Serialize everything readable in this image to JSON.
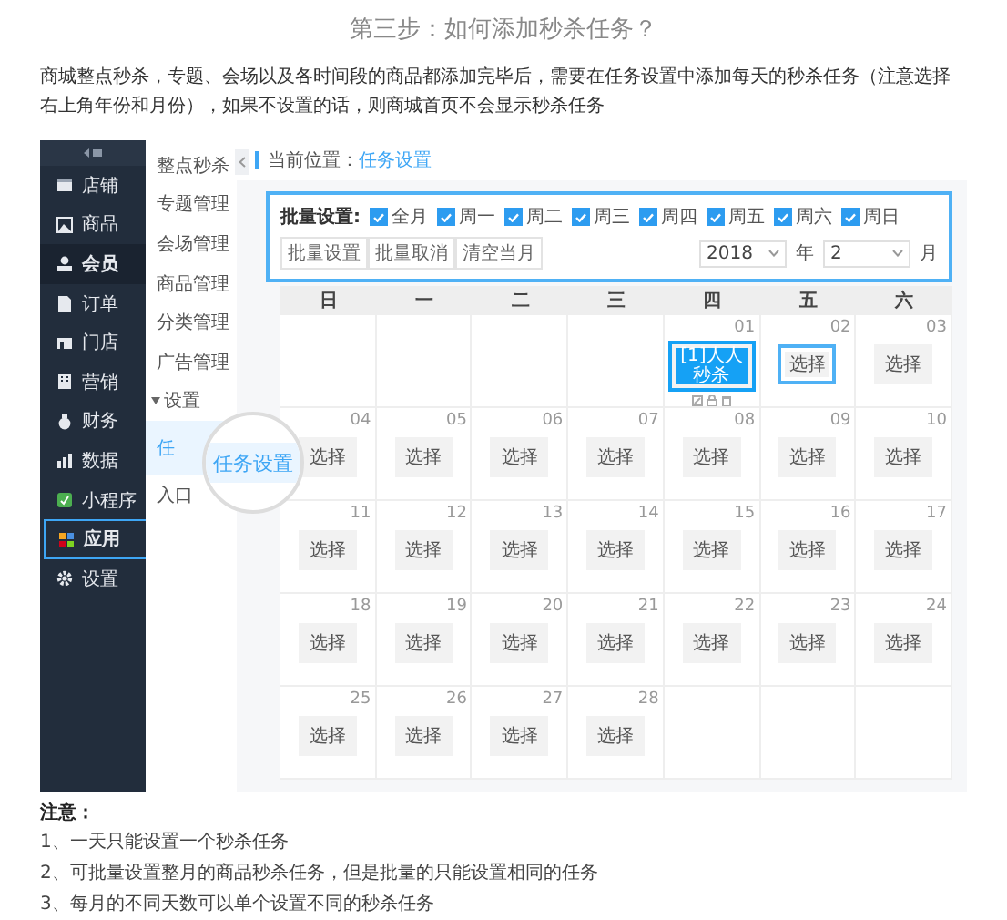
{
  "title": "第三步：如何添加秒杀任务？",
  "intro": "商城整点秒杀，专题、会场以及各时间段的商品都添加完毕后，需要在任务设置中添加每天的秒杀任务（注意选择右上角年份和月份），如果不设置的话，则商城首页不会显示秒杀任务",
  "app": {
    "sidebar": [
      {
        "label": "店铺",
        "selected": false,
        "outlined": false
      },
      {
        "label": "商品",
        "selected": false,
        "outlined": false
      },
      {
        "label": "会员",
        "selected": true,
        "outlined": false
      },
      {
        "label": "订单",
        "selected": false,
        "outlined": false
      },
      {
        "label": "门店",
        "selected": false,
        "outlined": false
      },
      {
        "label": "营销",
        "selected": false,
        "outlined": false
      },
      {
        "label": "财务",
        "selected": false,
        "outlined": false
      },
      {
        "label": "数据",
        "selected": false,
        "outlined": false
      },
      {
        "label": "小程序",
        "selected": false,
        "outlined": false
      },
      {
        "label": "应用",
        "selected": false,
        "outlined": true
      },
      {
        "label": "设置",
        "selected": false,
        "outlined": false
      }
    ],
    "submenu": [
      {
        "label": "整点秒杀",
        "kind": "item",
        "selected": false
      },
      {
        "label": "专题管理",
        "kind": "item",
        "selected": false
      },
      {
        "label": "会场管理",
        "kind": "item",
        "selected": false
      },
      {
        "label": "商品管理",
        "kind": "item",
        "selected": false
      },
      {
        "label": "分类管理",
        "kind": "item",
        "selected": false
      },
      {
        "label": "广告管理",
        "kind": "item",
        "selected": false
      },
      {
        "label": "设置",
        "kind": "group",
        "selected": false
      },
      {
        "label": "任",
        "kind": "item",
        "selected": true
      },
      {
        "label": "入口",
        "kind": "item",
        "selected": false
      }
    ],
    "breadcrumb": {
      "label": "当前位置：",
      "current": "任务设置"
    },
    "batch": {
      "label": "批量设置:",
      "options": [
        {
          "label": "全月",
          "checked": true
        },
        {
          "label": "周一",
          "checked": true
        },
        {
          "label": "周二",
          "checked": true
        },
        {
          "label": "周三",
          "checked": true
        },
        {
          "label": "周四",
          "checked": true
        },
        {
          "label": "周五",
          "checked": true
        },
        {
          "label": "周六",
          "checked": true
        },
        {
          "label": "周日",
          "checked": true
        }
      ],
      "buttons": [
        "批量设置",
        "批量取消",
        "清空当月"
      ],
      "year": "2018",
      "year_unit": "年",
      "month": "2",
      "month_unit": "月"
    },
    "calendar": {
      "weekdays": [
        "日",
        "一",
        "二",
        "三",
        "四",
        "五",
        "六"
      ],
      "weeks": [
        [
          {
            "day": "01",
            "kind": "task",
            "label": "[1]人人秒杀",
            "selected": false
          },
          {
            "day": "02",
            "kind": "choose",
            "label": "选择",
            "selected": true
          },
          {
            "day": "03",
            "kind": "choose",
            "label": "选择",
            "selected": false
          }
        ],
        [
          {
            "day": "04",
            "kind": "choose",
            "label": "选择",
            "selected": false
          },
          {
            "day": "05",
            "kind": "choose",
            "label": "选择",
            "selected": false
          },
          {
            "day": "06",
            "kind": "choose",
            "label": "选择",
            "selected": false
          },
          {
            "day": "07",
            "kind": "choose",
            "label": "选择",
            "selected": false
          },
          {
            "day": "08",
            "kind": "choose",
            "label": "选择",
            "selected": false
          },
          {
            "day": "09",
            "kind": "choose",
            "label": "选择",
            "selected": false
          },
          {
            "day": "10",
            "kind": "choose",
            "label": "选择",
            "selected": false
          }
        ],
        [
          {
            "day": "11",
            "kind": "choose",
            "label": "选择",
            "selected": false
          },
          {
            "day": "12",
            "kind": "choose",
            "label": "选择",
            "selected": false
          },
          {
            "day": "13",
            "kind": "choose",
            "label": "选择",
            "selected": false
          },
          {
            "day": "14",
            "kind": "choose",
            "label": "选择",
            "selected": false
          },
          {
            "day": "15",
            "kind": "choose",
            "label": "选择",
            "selected": false
          },
          {
            "day": "16",
            "kind": "choose",
            "label": "选择",
            "selected": false
          },
          {
            "day": "17",
            "kind": "choose",
            "label": "选择",
            "selected": false
          }
        ],
        [
          {
            "day": "18",
            "kind": "choose",
            "label": "选择",
            "selected": false
          },
          {
            "day": "19",
            "kind": "choose",
            "label": "选择",
            "selected": false
          },
          {
            "day": "20",
            "kind": "choose",
            "label": "选择",
            "selected": false
          },
          {
            "day": "21",
            "kind": "choose",
            "label": "选择",
            "selected": false
          },
          {
            "day": "22",
            "kind": "choose",
            "label": "选择",
            "selected": false
          },
          {
            "day": "23",
            "kind": "choose",
            "label": "选择",
            "selected": false
          },
          {
            "day": "24",
            "kind": "choose",
            "label": "选择",
            "selected": false
          }
        ],
        [
          {
            "day": "25",
            "kind": "choose",
            "label": "选择",
            "selected": false
          },
          {
            "day": "26",
            "kind": "choose",
            "label": "选择",
            "selected": false
          },
          {
            "day": "27",
            "kind": "choose",
            "label": "选择",
            "selected": false
          },
          {
            "day": "28",
            "kind": "choose",
            "label": "选择",
            "selected": false
          }
        ]
      ]
    },
    "magnifier": {
      "text": "任务设置"
    }
  },
  "notes": {
    "title": "注意：",
    "items": [
      "1、一天只能设置一个秒杀任务",
      "2、可批量设置整月的商品秒杀任务，但是批量的只能设置相同的任务",
      "3、每月的不同天数可以单个设置不同的秒杀任务"
    ]
  }
}
